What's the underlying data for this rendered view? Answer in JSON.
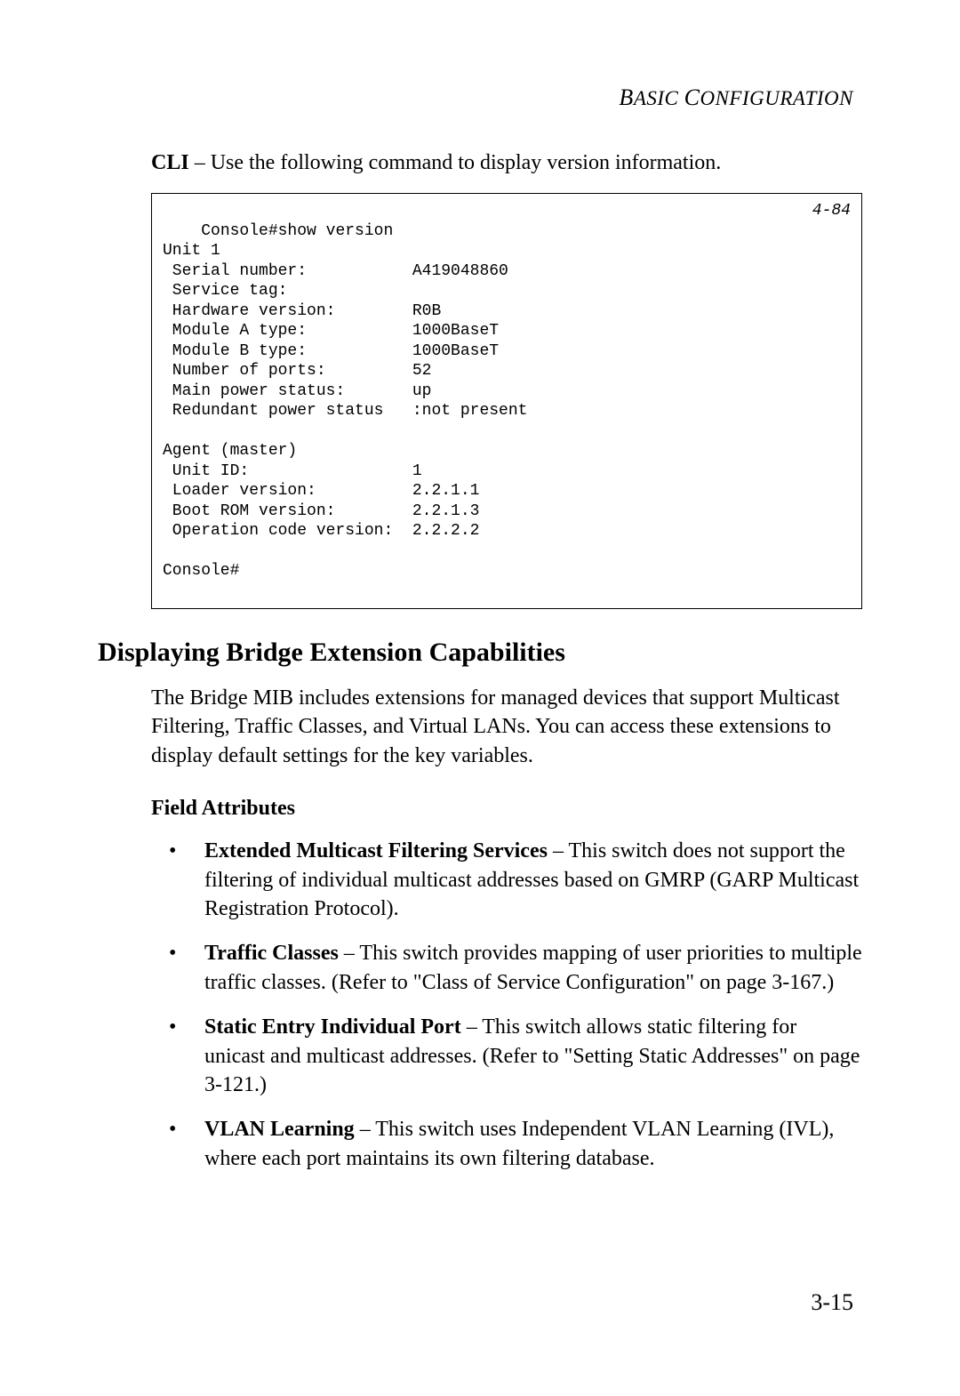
{
  "header": {
    "title_part1": "B",
    "title_part2": "ASIC ",
    "title_part3": "C",
    "title_part4": "ONFIGURATION"
  },
  "cli": {
    "prefix": "CLI",
    "intro_rest": " – Use the following command to display version information.",
    "code_ref": "4-84",
    "code_text": "Console#show version\nUnit 1\n Serial number:           A419048860\n Service tag:\n Hardware version:        R0B\n Module A type:           1000BaseT\n Module B type:           1000BaseT\n Number of ports:         52\n Main power status:       up\n Redundant power status   :not present\n\nAgent (master)\n Unit ID:                 1\n Loader version:          2.2.1.1\n Boot ROM version:        2.2.1.3\n Operation code version:  2.2.2.2\n\nConsole#"
  },
  "section": {
    "heading": "Displaying Bridge Extension Capabilities",
    "paragraph": "The Bridge MIB includes extensions for managed devices that support Multicast Filtering, Traffic Classes, and Virtual LANs. You can access these extensions to display default settings for the key variables."
  },
  "field": {
    "heading": "Field Attributes",
    "items": [
      {
        "bold": "Extended Multicast Filtering Services",
        "rest": " – This switch does not support the filtering of individual multicast addresses based on GMRP (GARP Multicast Registration Protocol)."
      },
      {
        "bold": "Traffic Classes",
        "rest": " – This switch provides mapping of user priorities to multiple traffic classes. (Refer to \"Class of Service Configuration\" on page 3-167.)"
      },
      {
        "bold": "Static Entry Individual Port",
        "rest": " – This switch allows static filtering for unicast and multicast addresses. (Refer to \"Setting Static Addresses\" on page 3-121.)"
      },
      {
        "bold": "VLAN Learning",
        "rest": " – This switch uses Independent VLAN Learning (IVL), where each port maintains its own filtering database."
      }
    ]
  },
  "page_number": "3-15"
}
